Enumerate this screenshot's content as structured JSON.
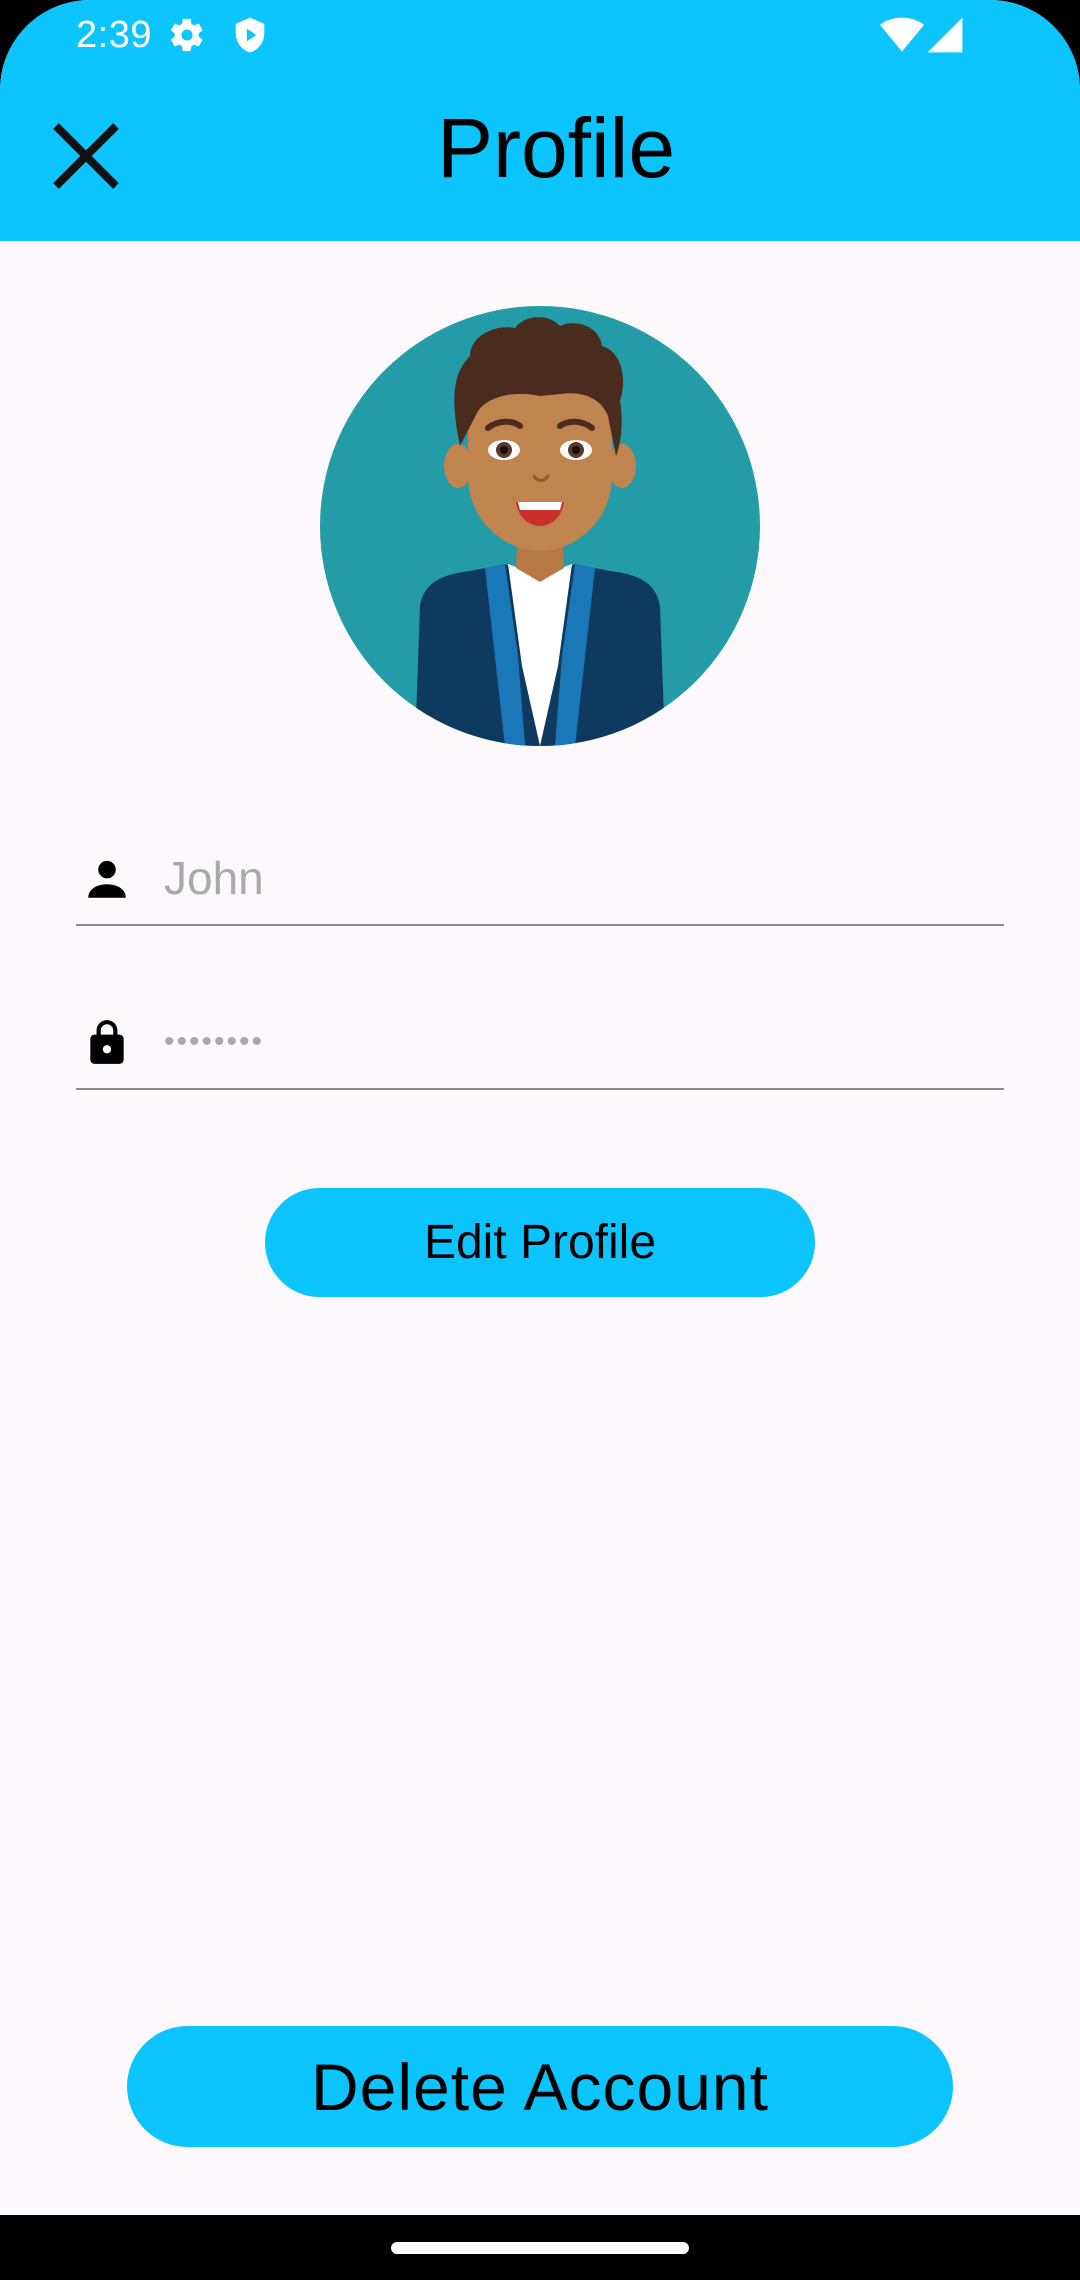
{
  "status_bar": {
    "time": "2:39",
    "icons": [
      "settings-icon",
      "shield-play-icon",
      "wifi-icon",
      "cellular-signal-icon"
    ]
  },
  "app_bar": {
    "title": "Profile",
    "close_icon": "close-icon",
    "background_color": "#0CC5FF"
  },
  "avatar": {
    "icon": "user-avatar-illustration"
  },
  "form": {
    "username": {
      "icon": "person-icon",
      "placeholder": "John",
      "value": ""
    },
    "password": {
      "icon": "lock-icon",
      "placeholder": "••••••••",
      "value": ""
    }
  },
  "buttons": {
    "edit_profile": "Edit Profile",
    "delete_account": "Delete Account"
  },
  "colors": {
    "accent": "#0CC5FF",
    "background": "#FDF8FC",
    "hint_text": "#A9A9A9"
  }
}
